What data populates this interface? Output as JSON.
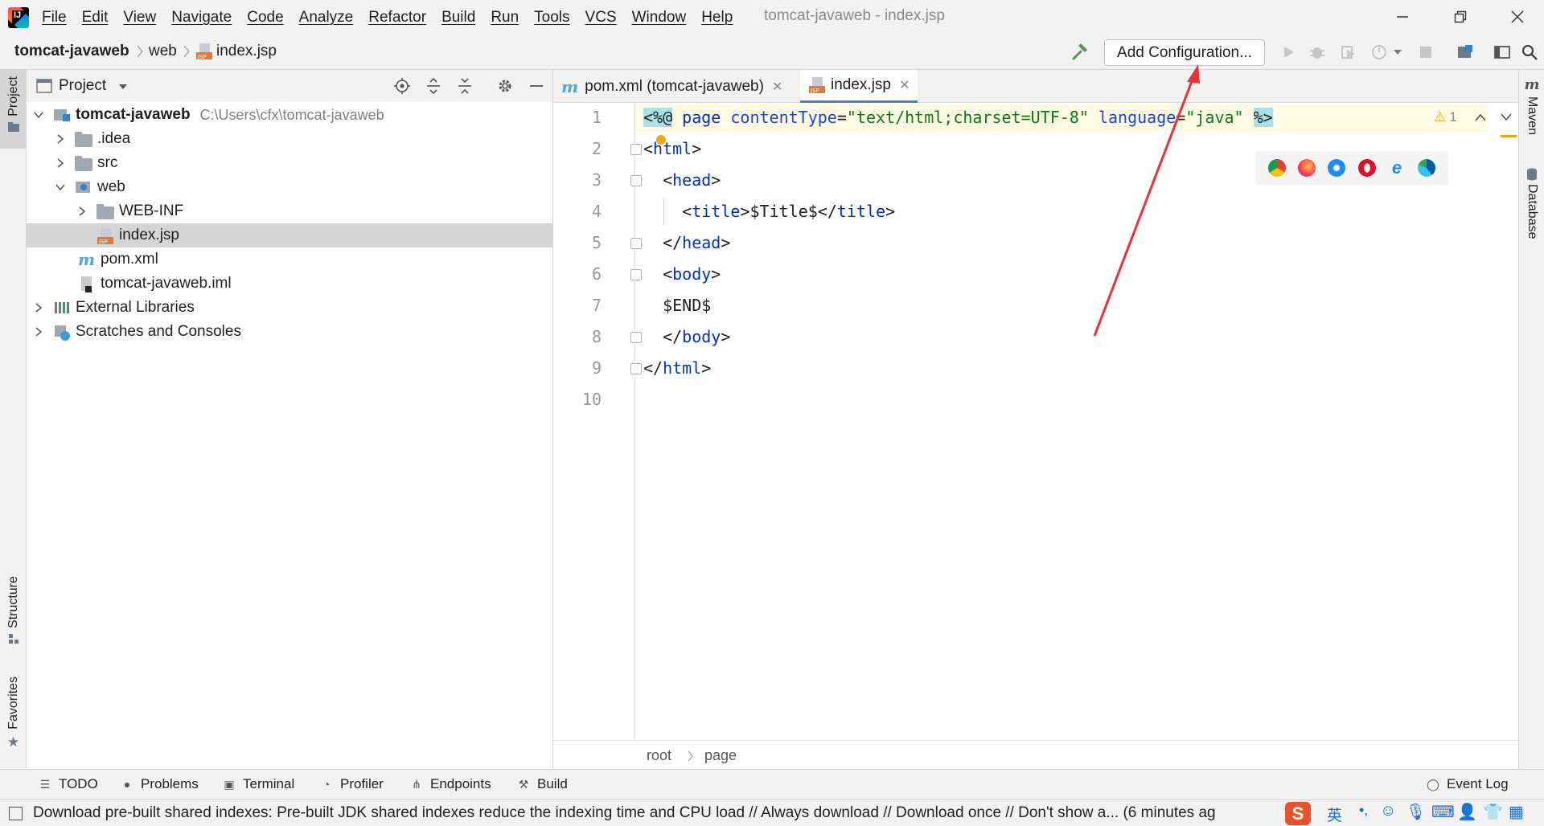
{
  "menu": {
    "items": [
      "File",
      "Edit",
      "View",
      "Navigate",
      "Code",
      "Analyze",
      "Refactor",
      "Build",
      "Run",
      "Tools",
      "VCS",
      "Window",
      "Help"
    ],
    "window_title": "tomcat-javaweb - index.jsp"
  },
  "navbar": {
    "crumbs": [
      "tomcat-javaweb",
      "web",
      "index.jsp"
    ],
    "config_button": "Add Configuration..."
  },
  "left_stripe": {
    "project": "Project",
    "structure": "Structure",
    "favorites": "Favorites"
  },
  "right_stripe": {
    "maven": "Maven",
    "database": "Database"
  },
  "project": {
    "title": "Project",
    "tree": [
      {
        "label": "tomcat-javaweb",
        "hint": "C:\\Users\\cfx\\tomcat-javaweb",
        "icon": "module-folder-icon",
        "expanded": true
      },
      {
        "label": ".idea",
        "icon": "folder-icon",
        "expanded": false
      },
      {
        "label": "src",
        "icon": "folder-icon",
        "expanded": false
      },
      {
        "label": "web",
        "icon": "web-folder-icon",
        "expanded": true
      },
      {
        "label": "WEB-INF",
        "icon": "folder-icon",
        "expanded": false
      },
      {
        "label": "index.jsp",
        "icon": "jsp-file-icon",
        "selected": true
      },
      {
        "label": "pom.xml",
        "icon": "maven-file-icon"
      },
      {
        "label": "tomcat-javaweb.iml",
        "icon": "iml-file-icon"
      },
      {
        "label": "External Libraries",
        "icon": "libraries-icon",
        "expanded": false
      },
      {
        "label": "Scratches and Consoles",
        "icon": "scratches-icon",
        "expanded": false
      }
    ]
  },
  "editor": {
    "tabs": [
      {
        "label": "pom.xml (tomcat-javaweb)",
        "active": false
      },
      {
        "label": "index.jsp",
        "active": true
      }
    ],
    "line_numbers": [
      "1",
      "2",
      "3",
      "4",
      "5",
      "6",
      "7",
      "8",
      "9",
      "10"
    ],
    "code": {
      "l1_open": "<%@",
      "l1_page": " page ",
      "l1_attr1": "contentType",
      "l1_eq1": "=",
      "l1_val1": "\"text/html;charset=UTF-8\"",
      "l1_attr2": " language",
      "l1_eq2": "=",
      "l1_val2": "\"java\"",
      "l1_close": "%>",
      "l2": "html",
      "l3": "head",
      "l4_tag_open": "title",
      "l4_text": "$Title$",
      "l4_tag_close": "title",
      "l5": "head",
      "l6": "body",
      "l7": "$END$",
      "l8": "body",
      "l9": "html"
    },
    "warning_count": "1",
    "bottom_crumbs": [
      "root",
      "page"
    ]
  },
  "tool_windows": [
    "TODO",
    "Problems",
    "Terminal",
    "Profiler",
    "Endpoints",
    "Build"
  ],
  "event_log": "Event Log",
  "status_text": "Download pre-built shared indexes: Pre-built JDK shared indexes reduce the indexing time and CPU load // Always download // Download once // Don't show a... (6 minutes ag",
  "ime_label": "英",
  "colors": {
    "accent": "#4083c9",
    "annotation_arrow": "#e8323c"
  }
}
